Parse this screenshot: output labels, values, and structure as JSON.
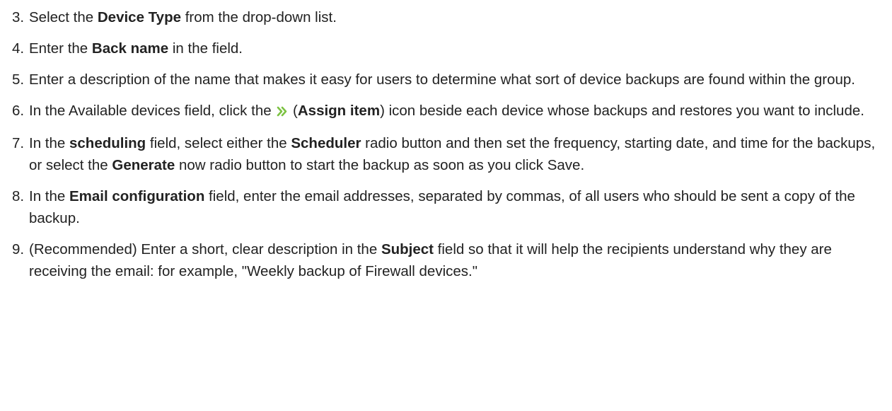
{
  "icons": {
    "assign_item": "double-chevron-right-icon",
    "assign_item_color": "#7cc242"
  },
  "steps": [
    {
      "number": "3.",
      "parts": [
        "Select the ",
        "Device Type",
        " from the drop-down list."
      ]
    },
    {
      "number": "4.",
      "parts": [
        "Enter the ",
        "Back name",
        " in the field."
      ]
    },
    {
      "number": "5.",
      "parts": [
        "Enter a description of the name that makes it easy for users to determine what sort of device backups are found within the group."
      ]
    },
    {
      "number": "6.",
      "parts": [
        "In the Available devices field, click the ",
        " (",
        "Assign item",
        ") icon beside each device whose backups and restores you want to include."
      ]
    },
    {
      "number": "7.",
      "parts": [
        "In the ",
        "scheduling",
        " field, select either the ",
        "Scheduler",
        " radio button and then set the frequency, starting date, and time for the backups, or select the ",
        "Generate",
        " now radio button to start the backup as soon as you click Save."
      ]
    },
    {
      "number": "8.",
      "parts": [
        "In the ",
        "Email configuration",
        " field, enter the email addresses, separated by commas, of all users who should be sent a copy of the backup."
      ]
    },
    {
      "number": "9.",
      "parts": [
        "(Recommended) Enter a short, clear description in the ",
        "Subject",
        " field so that it will help the recipients understand why they are receiving the email: for example, \"Weekly backup of Firewall devices.\""
      ]
    }
  ]
}
